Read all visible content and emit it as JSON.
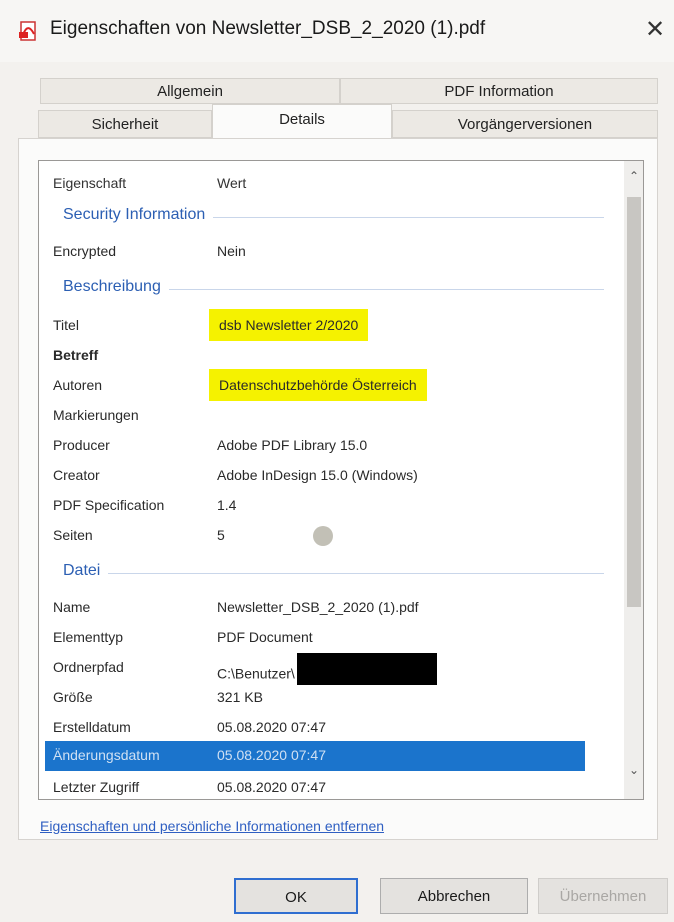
{
  "window": {
    "title": "Eigenschaften von Newsletter_DSB_2_2020 (1).pdf",
    "close_symbol": "✕",
    "icon": "pdf-icon"
  },
  "tabs": {
    "row1": [
      "Allgemein",
      "PDF Information"
    ],
    "row2": [
      "Sicherheit",
      "Details",
      "Vorgängerversionen"
    ],
    "active": "Details"
  },
  "details": {
    "header": {
      "key": "Eigenschaft",
      "value": "Wert"
    },
    "security_group": "Security Information",
    "encrypted": {
      "key": "Encrypted",
      "value": "Nein"
    },
    "description_group": "Beschreibung",
    "titel": {
      "key": "Titel",
      "value": "dsb Newsletter 2/2020"
    },
    "betreff": {
      "key": "Betreff",
      "value": ""
    },
    "autoren": {
      "key": "Autoren",
      "value": "Datenschutzbehörde Österreich"
    },
    "markierungen": {
      "key": "Markierungen",
      "value": ""
    },
    "producer": {
      "key": "Producer",
      "value": "Adobe PDF Library 15.0"
    },
    "creator": {
      "key": "Creator",
      "value": "Adobe InDesign 15.0 (Windows)"
    },
    "pdf_spec": {
      "key": "PDF Specification",
      "value": "1.4"
    },
    "seiten": {
      "key": "Seiten",
      "value": "5"
    },
    "file_group": "Datei",
    "name": {
      "key": "Name",
      "value": "Newsletter_DSB_2_2020 (1).pdf"
    },
    "elementtyp": {
      "key": "Elementtyp",
      "value": "PDF Document"
    },
    "ordnerpfad": {
      "key": "Ordnerpfad",
      "value": "C:\\Benutzer\\"
    },
    "groesse": {
      "key": "Größe",
      "value": "321 KB"
    },
    "erstelldatum": {
      "key": "Erstelldatum",
      "value": "05.08.2020 07:47"
    },
    "aenderungsdatum": {
      "key": "Änderungsdatum",
      "value": "05.08.2020 07:47"
    },
    "letzter_zugriff": {
      "key": "Letzter Zugriff",
      "value": "05.08.2020 07:47"
    }
  },
  "highlight_color": "#f5f200",
  "selection_color": "#1b74cc",
  "remove_link": "Eigenschaften und persönliche Informationen entfernen",
  "buttons": {
    "ok": "OK",
    "cancel": "Abbrechen",
    "apply": "Übernehmen"
  },
  "scrollbar": {
    "up": "⌃",
    "down": "⌄"
  }
}
